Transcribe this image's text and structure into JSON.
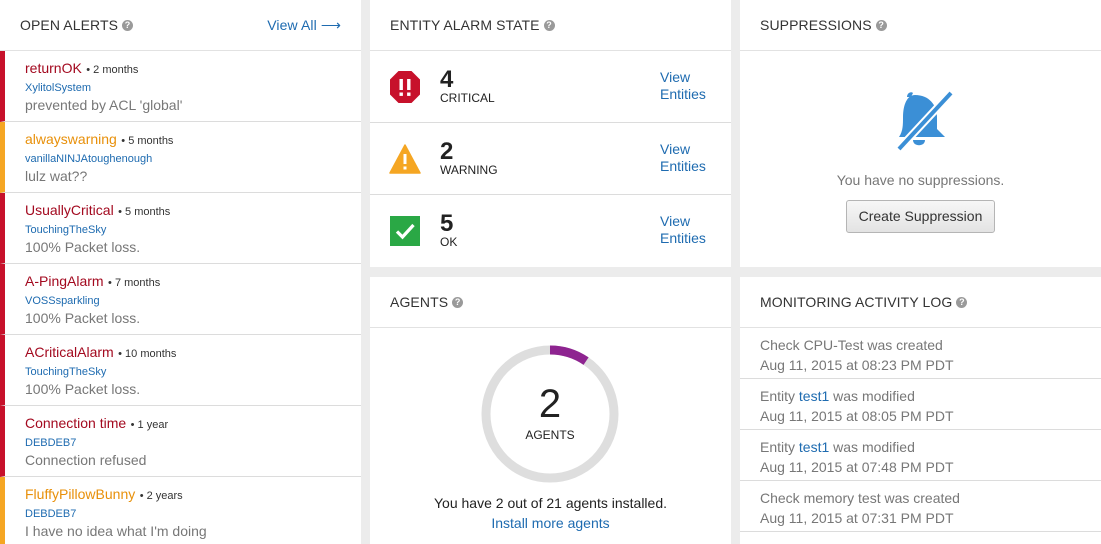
{
  "open_alerts": {
    "title": "OPEN ALERTS",
    "view_all": "View All",
    "items": [
      {
        "name": "returnOK",
        "age": "• 2 months",
        "entity": "XylitolSystem",
        "message": "prevented by ACL 'global'",
        "severity": "critical"
      },
      {
        "name": "alwayswarning",
        "age": "• 5 months",
        "entity": "vanillaNINJAtoughenough",
        "message": "lulz wat??",
        "severity": "warning"
      },
      {
        "name": "UsuallyCritical",
        "age": "• 5 months",
        "entity": "TouchingTheSky",
        "message": "100% Packet loss.",
        "severity": "critical"
      },
      {
        "name": "A-PingAlarm",
        "age": "• 7 months",
        "entity": "VOSSsparkling",
        "message": "100% Packet loss.",
        "severity": "critical"
      },
      {
        "name": "ACriticalAlarm",
        "age": "• 10 months",
        "entity": "TouchingTheSky",
        "message": "100% Packet loss.",
        "severity": "critical"
      },
      {
        "name": "Connection time",
        "age": "• 1 year",
        "entity": "DEBDEB7",
        "message": "Connection refused",
        "severity": "critical"
      },
      {
        "name": "FluffyPillowBunny",
        "age": "• 2 years",
        "entity": "DEBDEB7",
        "message": "I have no idea what I'm doing",
        "severity": "warning"
      }
    ]
  },
  "entity_alarm_state": {
    "title": "ENTITY ALARM STATE",
    "rows": [
      {
        "count": "4",
        "label": "CRITICAL",
        "link_line1": "View",
        "link_line2": "Entities",
        "icon": "critical-octagon-icon"
      },
      {
        "count": "2",
        "label": "WARNING",
        "link_line1": "View",
        "link_line2": "Entities",
        "icon": "warning-triangle-icon"
      },
      {
        "count": "5",
        "label": "OK",
        "link_line1": "View",
        "link_line2": "Entities",
        "icon": "ok-check-icon"
      }
    ]
  },
  "suppressions": {
    "title": "SUPPRESSIONS",
    "empty_message": "You have no suppressions.",
    "button": "Create Suppression",
    "icon": "bell-slash-icon"
  },
  "agents": {
    "title": "AGENTS",
    "count": "2",
    "unit": "AGENTS",
    "installed": 2,
    "total": 21,
    "summary": "You have 2 out of 21 agents installed.",
    "install_link": "Install more agents"
  },
  "activity_log": {
    "title": "MONITORING ACTIVITY LOG",
    "items": [
      {
        "before": "Check CPU-Test was created",
        "link": "",
        "after": "",
        "time": "Aug 11, 2015 at 08:23 PM PDT"
      },
      {
        "before": "Entity ",
        "link": "test1",
        "after": " was modified",
        "time": "Aug 11, 2015 at 08:05 PM PDT"
      },
      {
        "before": "Entity ",
        "link": "test1",
        "after": " was modified",
        "time": "Aug 11, 2015 at 07:48 PM PDT"
      },
      {
        "before": "Check memory test was created",
        "link": "",
        "after": "",
        "time": "Aug 11, 2015 at 07:31 PM PDT"
      }
    ]
  },
  "colors": {
    "critical": "#c7112b",
    "warning": "#f5a623",
    "ok": "#2aa845",
    "link": "#1e6bb0",
    "gauge": "#8e2490"
  }
}
